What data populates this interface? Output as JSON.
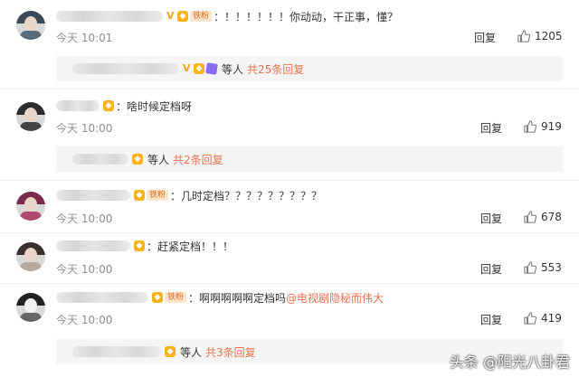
{
  "comments": [
    {
      "text": "：！！！！！！你动动，干正事，懂？",
      "time": "今天 10:01",
      "reply": "回复",
      "likes": "1205",
      "fan_badge": "铁粉",
      "thread": {
        "others": "等人",
        "count": "共25条回复"
      }
    },
    {
      "text": "：啥时候定档呀",
      "time": "今天 10:00",
      "reply": "回复",
      "likes": "919",
      "thread": {
        "others": "等人",
        "count": "共2条回复"
      }
    },
    {
      "text": "：几时定档？？？？？？？？？",
      "time": "今天 10:00",
      "reply": "回复",
      "likes": "678",
      "fan_badge": "铁粉"
    },
    {
      "text": "：赶紧定档！！！",
      "time": "今天 10:00",
      "reply": "回复",
      "likes": "553"
    },
    {
      "text": "：啊啊啊啊啊定档吗",
      "mention": "@电视剧隐秘而伟大",
      "time": "今天 10:00",
      "reply": "回复",
      "likes": "419",
      "fan_badge": "铁粉",
      "thread": {
        "others": "等人",
        "count": "共3条回复"
      }
    }
  ],
  "watermark": "头条 @阳光八卦君",
  "colors": {
    "link": "#eb7350",
    "meta": "#8f8f8f",
    "thread_bg": "#f5f5f5"
  }
}
